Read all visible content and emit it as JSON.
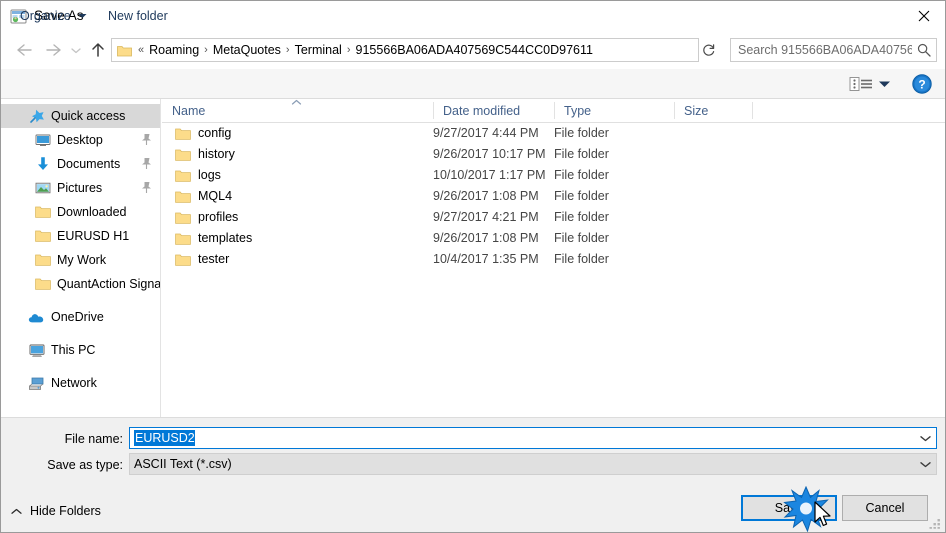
{
  "window": {
    "title": "Save As",
    "icon": "app-window-icon",
    "close_label": "✕"
  },
  "navigation": {
    "back_icon": "arrow-left-icon",
    "forward_icon": "arrow-right-icon",
    "recent_icon": "chevron-down-icon",
    "up_icon": "arrow-up-icon",
    "address": {
      "folder_icon": "folder-icon",
      "prefix": "«",
      "crumbs": [
        "Roaming",
        "MetaQuotes",
        "Terminal",
        "915566BA06ADA407569C544CC0D97611"
      ],
      "separator": "›",
      "dropdown_icon": "chevron-down-icon",
      "refresh_icon": "refresh-icon"
    },
    "search": {
      "placeholder": "Search 915566BA06ADA40756...",
      "icon": "search-icon"
    }
  },
  "command_bar": {
    "organize": "Organize",
    "new_folder": "New folder",
    "organize_caret": "caret-down-icon",
    "view_mode_icon": "view-list-icon",
    "view_mode_caret": "caret-down-icon",
    "help_icon": "help-question-icon",
    "help_label": "?"
  },
  "sidebar": {
    "items": [
      {
        "label": "Quick access",
        "icon": "star-pin-icon",
        "level": 0,
        "selected": true,
        "pinned": false
      },
      {
        "label": "Desktop",
        "icon": "desktop-icon",
        "level": 1,
        "selected": false,
        "pinned": true
      },
      {
        "label": "Documents",
        "icon": "documents-icon",
        "level": 1,
        "selected": false,
        "pinned": true
      },
      {
        "label": "Pictures",
        "icon": "pictures-icon",
        "level": 1,
        "selected": false,
        "pinned": true
      },
      {
        "label": "Downloaded",
        "icon": "folder-icon",
        "level": 1,
        "selected": false,
        "pinned": false
      },
      {
        "label": "EURUSD H1",
        "icon": "folder-icon",
        "level": 1,
        "selected": false,
        "pinned": false
      },
      {
        "label": "My Work",
        "icon": "folder-icon",
        "level": 1,
        "selected": false,
        "pinned": false
      },
      {
        "label": "QuantAction Signal",
        "icon": "folder-icon",
        "level": 1,
        "selected": false,
        "pinned": false
      },
      {
        "label": "OneDrive",
        "icon": "onedrive-cloud-icon",
        "level": 0,
        "selected": false,
        "pinned": false,
        "gap_before": true
      },
      {
        "label": "This PC",
        "icon": "this-pc-icon",
        "level": 0,
        "selected": false,
        "pinned": false,
        "gap_before": true
      },
      {
        "label": "Network",
        "icon": "network-icon",
        "level": 0,
        "selected": false,
        "pinned": false,
        "gap_before": true
      }
    ]
  },
  "file_list": {
    "columns": [
      "Name",
      "Date modified",
      "Type",
      "Size"
    ],
    "sort_column": "Name",
    "sort_direction": "ascending",
    "rows": [
      {
        "name": "config",
        "date": "9/27/2017 4:44 PM",
        "type": "File folder",
        "size": "",
        "icon": "folder-icon"
      },
      {
        "name": "history",
        "date": "9/26/2017 10:17 PM",
        "type": "File folder",
        "size": "",
        "icon": "folder-icon"
      },
      {
        "name": "logs",
        "date": "10/10/2017 1:17 PM",
        "type": "File folder",
        "size": "",
        "icon": "folder-icon"
      },
      {
        "name": "MQL4",
        "date": "9/26/2017 1:08 PM",
        "type": "File folder",
        "size": "",
        "icon": "folder-icon"
      },
      {
        "name": "profiles",
        "date": "9/27/2017 4:21 PM",
        "type": "File folder",
        "size": "",
        "icon": "folder-icon"
      },
      {
        "name": "templates",
        "date": "9/26/2017 1:08 PM",
        "type": "File folder",
        "size": "",
        "icon": "folder-icon"
      },
      {
        "name": "tester",
        "date": "10/4/2017 1:35 PM",
        "type": "File folder",
        "size": "",
        "icon": "folder-icon"
      }
    ]
  },
  "form": {
    "filename_label": "File name:",
    "filename_value": "EURUSD2",
    "filename_selected": true,
    "savetype_label": "Save as type:",
    "savetype_value": "ASCII Text (*.csv)",
    "combo_arrow_icon": "chevron-down-icon"
  },
  "footer": {
    "hide_folders": "Hide Folders",
    "hide_folders_icon": "chevron-up-icon",
    "save_button": "Save",
    "cancel_button": "Cancel",
    "resize_grip_icon": "resize-grip-icon",
    "click_burst_icon": "click-burst-icon",
    "cursor_icon": "mouse-pointer-icon"
  },
  "colors": {
    "accent": "#0078d7",
    "selection": "#0078d7",
    "folder_yellow": "#ffd96b",
    "header_text": "#44618a",
    "command_text": "#1e395b",
    "sidebar_selected": "#d8d8d8"
  }
}
